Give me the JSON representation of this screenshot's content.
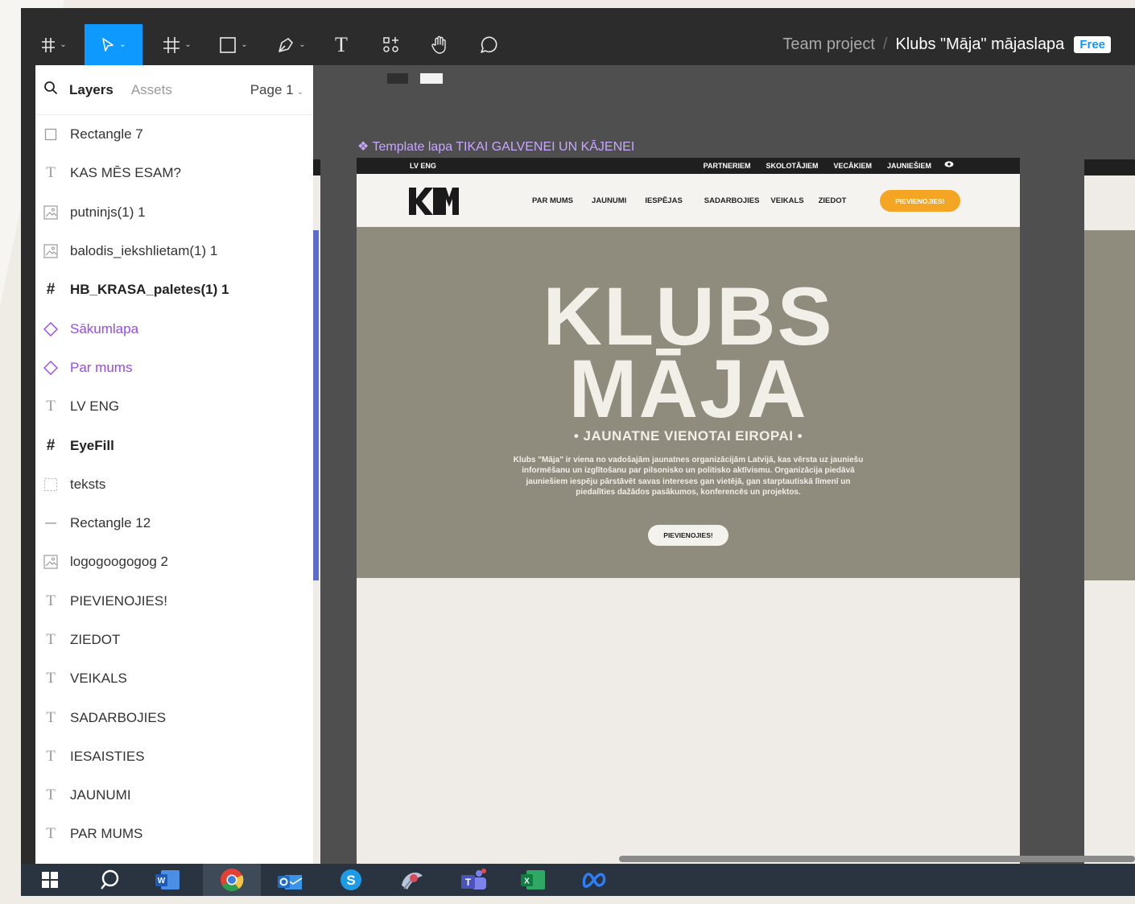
{
  "toolbar": {
    "project": "Team project",
    "separator": "/",
    "file_name": "Klubs \"Māja\" mājaslapa",
    "plan_badge": "Free",
    "accent_color": "#0d99ff",
    "tools": [
      "figma-menu-icon",
      "move-tool-icon",
      "frame-tool-icon",
      "rectangle-tool-icon",
      "pen-tool-icon",
      "text-tool-icon",
      "resources-icon",
      "hand-tool-icon",
      "comment-icon"
    ],
    "text_tool_glyph": "T"
  },
  "layers_panel": {
    "tab_layers": "Layers",
    "tab_assets": "Assets",
    "page": "Page 1",
    "items": [
      {
        "name": "Rectangle 7",
        "icon": "rectangle-icon",
        "glyph": "",
        "style": ""
      },
      {
        "name": "KAS MĒS ESAM?",
        "icon": "text-icon",
        "glyph": "T",
        "style": ""
      },
      {
        "name": "putninjs(1) 1",
        "icon": "image-icon",
        "glyph": "",
        "style": ""
      },
      {
        "name": "balodis_iekshlietam(1) 1",
        "icon": "image-icon",
        "glyph": "",
        "style": ""
      },
      {
        "name": "HB_KRASA_paletes(1) 1",
        "icon": "frame-icon",
        "glyph": "#",
        "style": "bold"
      },
      {
        "name": "Sākumlapa",
        "icon": "component-instance-icon",
        "glyph": "",
        "style": "comp"
      },
      {
        "name": "Par mums",
        "icon": "component-instance-icon",
        "glyph": "",
        "style": "comp"
      },
      {
        "name": "LV ENG",
        "icon": "text-icon",
        "glyph": "T",
        "style": ""
      },
      {
        "name": "EyeFill",
        "icon": "frame-icon",
        "glyph": "#",
        "style": "bold"
      },
      {
        "name": "teksts",
        "icon": "group-icon",
        "glyph": "",
        "style": ""
      },
      {
        "name": "Rectangle 12",
        "icon": "line-icon",
        "glyph": "",
        "style": ""
      },
      {
        "name": "logogoogogog 2",
        "icon": "image-icon",
        "glyph": "",
        "style": ""
      },
      {
        "name": "PIEVIENOJIES!",
        "icon": "text-icon",
        "glyph": "T",
        "style": ""
      },
      {
        "name": "ZIEDOT",
        "icon": "text-icon",
        "glyph": "T",
        "style": ""
      },
      {
        "name": "VEIKALS",
        "icon": "text-icon",
        "glyph": "T",
        "style": ""
      },
      {
        "name": "SADARBOJIES",
        "icon": "text-icon",
        "glyph": "T",
        "style": ""
      },
      {
        "name": "IESAISTIES",
        "icon": "text-icon",
        "glyph": "T",
        "style": ""
      },
      {
        "name": "JAUNUMI",
        "icon": "text-icon",
        "glyph": "T",
        "style": ""
      },
      {
        "name": "PAR MUMS",
        "icon": "text-icon",
        "glyph": "T",
        "style": ""
      }
    ]
  },
  "canvas": {
    "frame_label": "❖ Template lapa TIKAI GALVENEI UN KĀJENEI",
    "site": {
      "lang_switch": "LV  ENG",
      "top_links": [
        "PARTNERIEM",
        "SKOLOTĀJIEM",
        "VECĀKIEM",
        "JAUNIEŠIEM"
      ],
      "top_icon": "eye-icon",
      "logo_text": "KM",
      "nav": [
        "PAR MUMS",
        "JAUNUMI",
        "IESPĒJAS",
        "SADARBOJIES",
        "VEIKALS",
        "ZIEDOT"
      ],
      "nav_cta": "PIEVIENOJIES!",
      "hero_title_1": "KLUBS",
      "hero_title_2": "MĀJA",
      "hero_tagline": "• JAUNATNE VIENOTAI EIROPAI •",
      "hero_description": "Klubs \"Māja\" ir viena no vadošajām jaunatnes organizācijām Latvijā, kas vērsta uz jauniešu informēšanu un izglītošanu par pilsonisko un politisko aktīvismu. Organizācija piedāvā jauniešiem iespēju pārstāvēt savas intereses gan vietējā, gan starptautiskā līmenī un piedalīties dažādos pasākumos, konferencēs un projektos.",
      "hero_button": "PIEVIENOJIES!",
      "colors": {
        "hero": "#8f8b7d",
        "cta": "#f5a524",
        "header_bar": "#1f1f1f",
        "page": "#efece7"
      }
    }
  },
  "taskbar": {
    "apps": [
      "windows-start-icon",
      "search-icon",
      "word-icon",
      "chrome-icon",
      "outlook-icon",
      "skype-icon",
      "snipping-tool-icon",
      "teams-icon",
      "excel-icon",
      "meta-icon"
    ]
  }
}
